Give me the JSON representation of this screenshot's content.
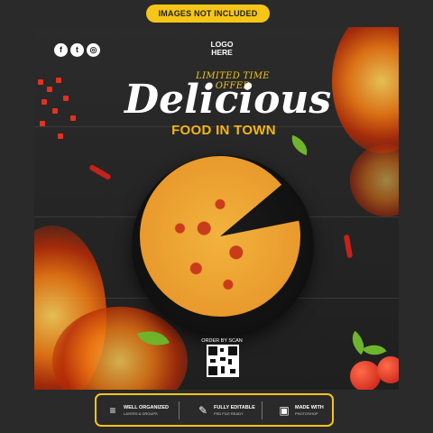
{
  "badge": "IMAGES NOT INCLUDED",
  "social": [
    {
      "icon": "facebook-icon",
      "glyph": "f"
    },
    {
      "icon": "twitter-icon",
      "glyph": "t"
    },
    {
      "icon": "instagram-icon",
      "glyph": "◎"
    }
  ],
  "logo": {
    "line1": "LOGO",
    "line2": "HERE"
  },
  "promo": {
    "limited": "LIMITED TIME OFFER",
    "title": "Delicious",
    "subtitle": "FOOD IN TOWN"
  },
  "order": {
    "label": "ORDER BY SCAN"
  },
  "footer": [
    {
      "icon": "layers-icon",
      "glyph": "≡",
      "title": "WELL ORGANIZED",
      "sub": "LAYERS & GROUPS"
    },
    {
      "icon": "edit-icon",
      "glyph": "✎",
      "title": "FULLY EDITABLE",
      "sub": "PSD FILE READY"
    },
    {
      "icon": "photoshop-icon",
      "glyph": "▣",
      "title": "MADE WITH",
      "sub": "PHOTOSHOP"
    }
  ],
  "colors": {
    "accent": "#f5c518",
    "background": "#2a2a2b"
  }
}
